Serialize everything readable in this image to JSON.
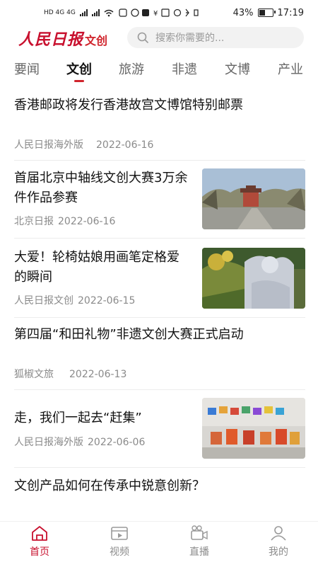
{
  "status_bar": {
    "network": "HD 4G 4G",
    "battery_percent": "43%",
    "time": "17:19"
  },
  "header": {
    "logo_brand": "人民日报",
    "logo_sub": "文创",
    "search_placeholder": "搜索你需要的..."
  },
  "tabs": [
    {
      "label": "要闻",
      "active": false
    },
    {
      "label": "文创",
      "active": true
    },
    {
      "label": "旅游",
      "active": false
    },
    {
      "label": "非遗",
      "active": false
    },
    {
      "label": "文博",
      "active": false
    },
    {
      "label": "产业",
      "active": false
    }
  ],
  "articles": [
    {
      "title": "香港邮政将发行香港故宫文博馆特别邮票",
      "source": "人民日报海外版",
      "date": "2022-06-16",
      "thumbnail": null
    },
    {
      "title": "首届北京中轴线文创大赛3万余件作品参赛",
      "source": "北京日报",
      "date": "2022-06-16",
      "thumbnail": "bell-tower-street-photo"
    },
    {
      "title": "大爱！轮椅姑娘用画笔定格爱的瞬间",
      "source": "人民日报文创",
      "date": "2022-06-15",
      "thumbnail": "protective-suit-painting"
    },
    {
      "title": "第四届“和田礼物”非遗文创大赛正式启动",
      "source": "狐椒文旅",
      "date": "2022-06-13",
      "thumbnail": null
    },
    {
      "title": "走，我们一起去“赶集”",
      "source": "人民日报海外版",
      "date": "2022-06-06",
      "thumbnail": "colorful-figurines-photo"
    },
    {
      "title": "文创产品如何在传承中锐意创新？",
      "source": "",
      "date": "",
      "thumbnail": null
    }
  ],
  "bottom_nav": [
    {
      "label": "首页",
      "icon": "home-icon",
      "active": true
    },
    {
      "label": "视频",
      "icon": "video-icon",
      "active": false
    },
    {
      "label": "直播",
      "icon": "camera-icon",
      "active": false
    },
    {
      "label": "我的",
      "icon": "user-icon",
      "active": false
    }
  ],
  "colors": {
    "accent": "#c8102e",
    "muted_text": "#8a8a8a",
    "divider": "#ececec"
  }
}
